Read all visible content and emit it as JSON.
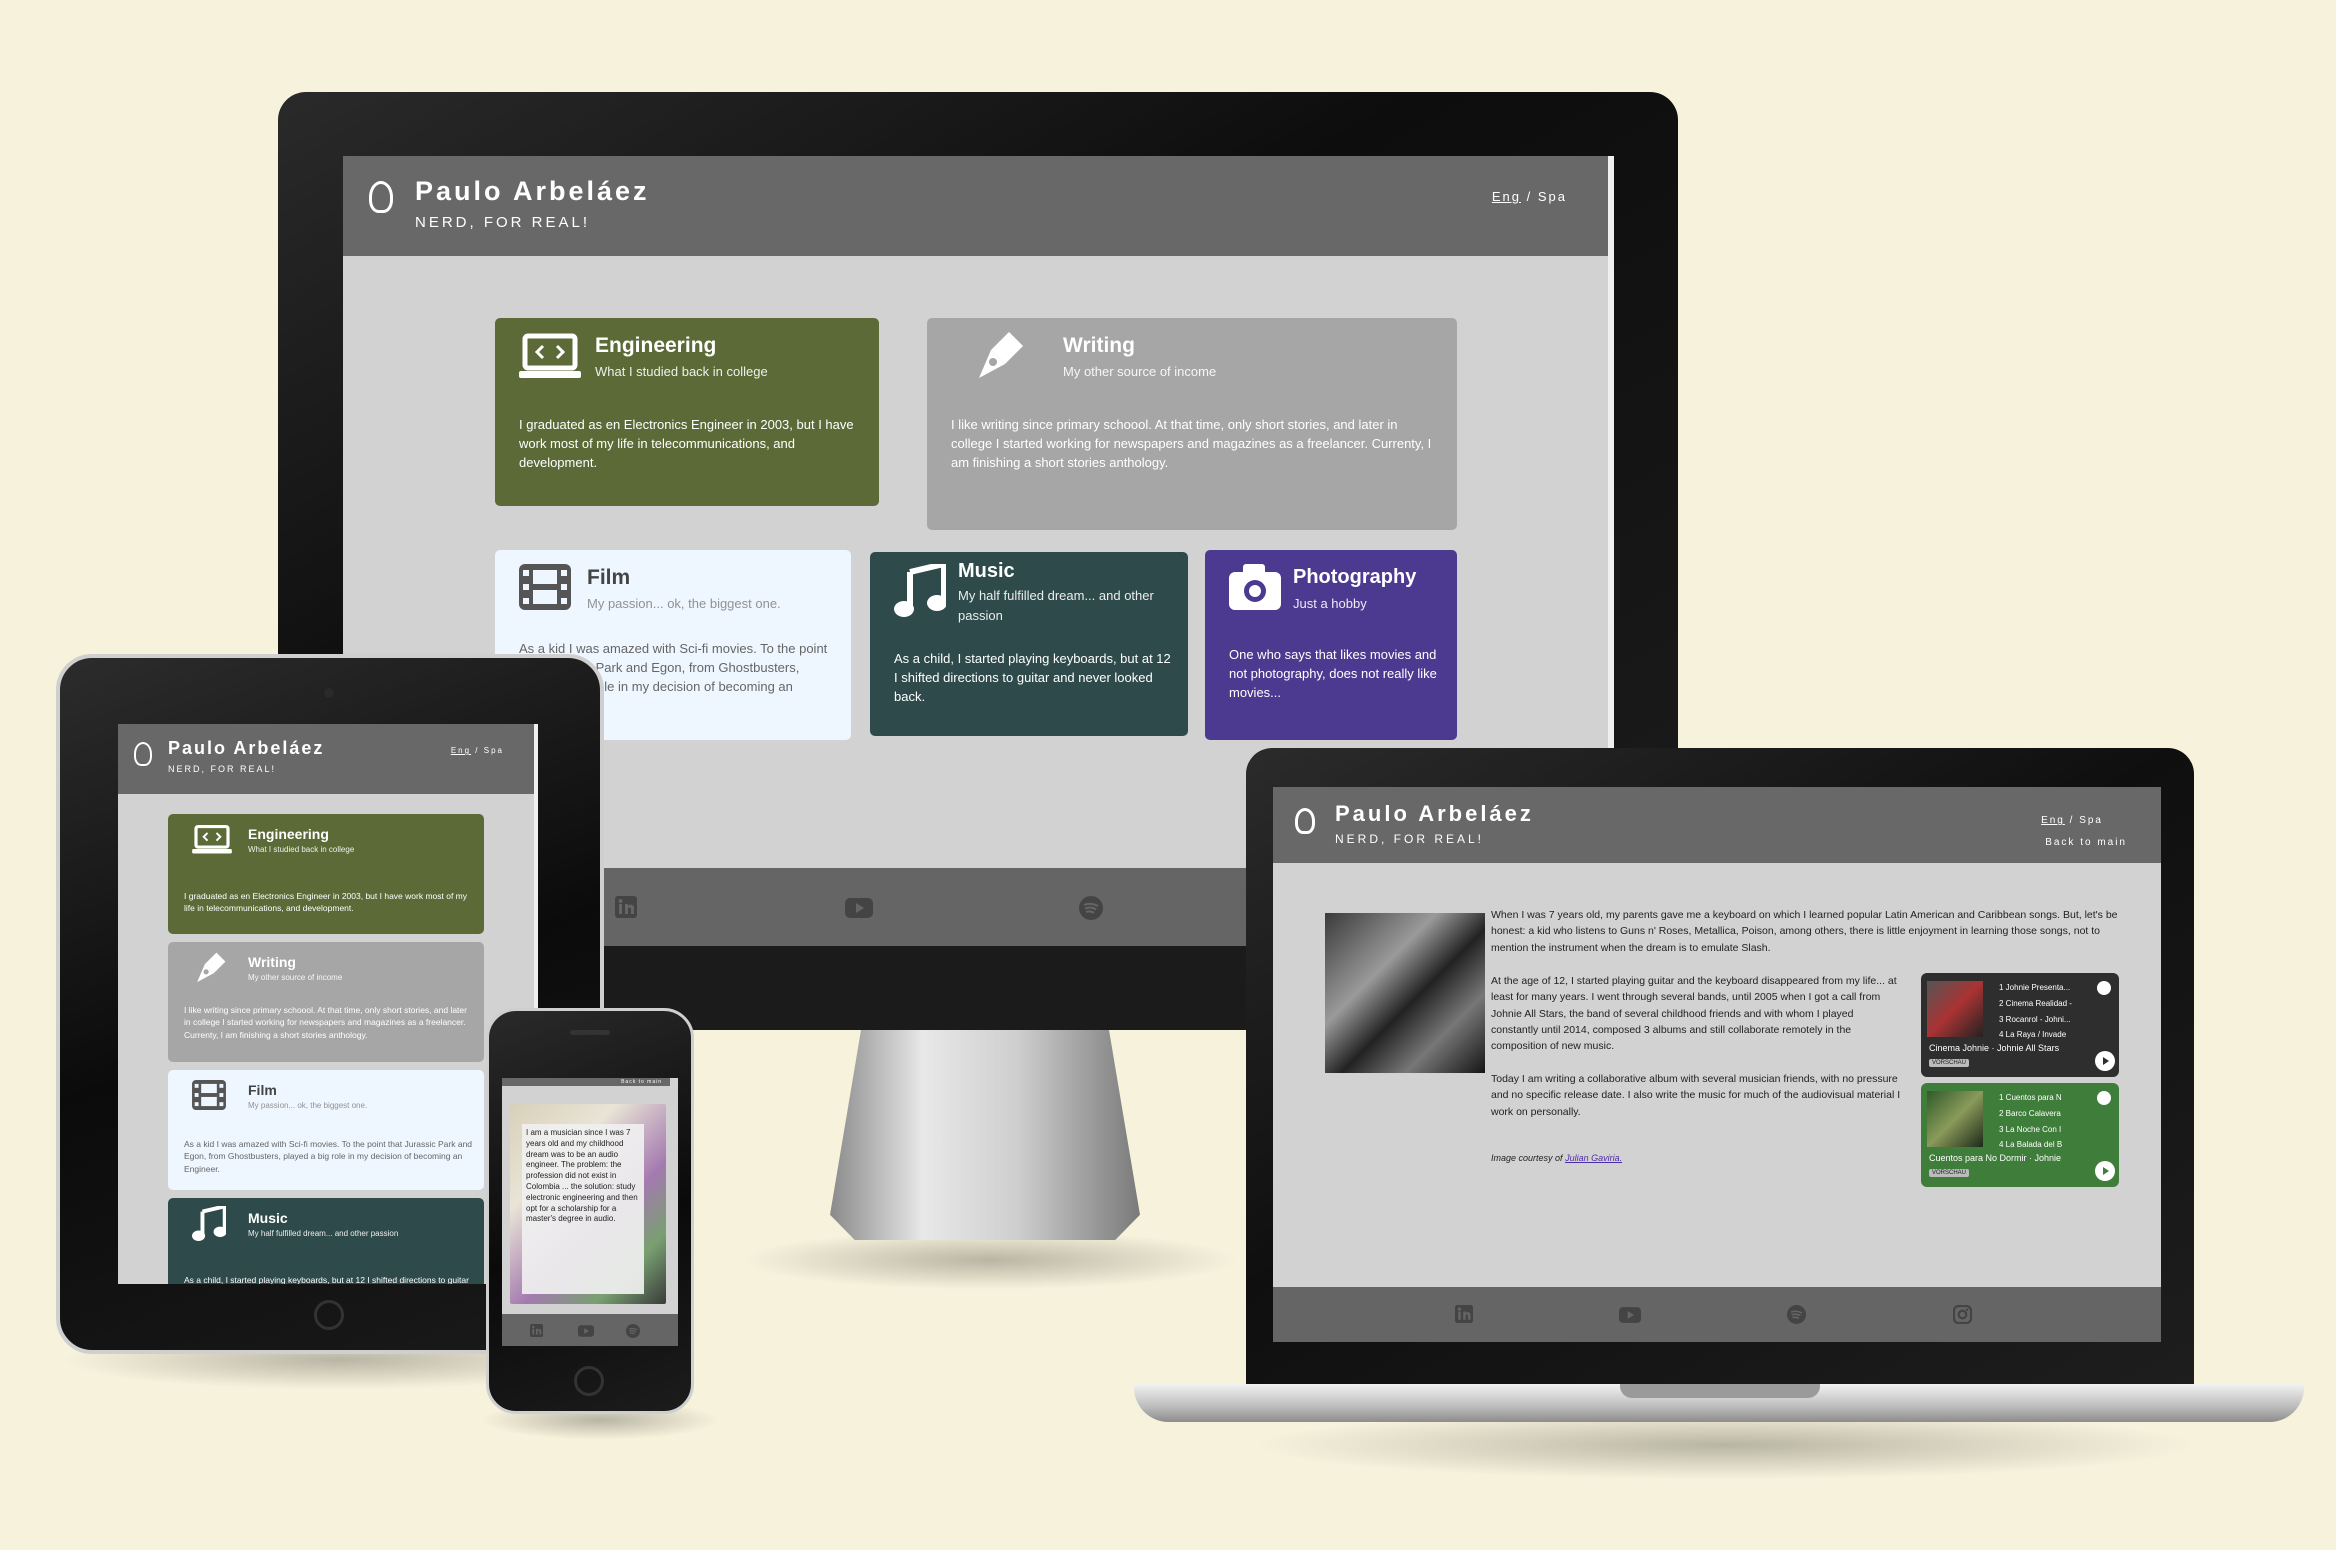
{
  "site": {
    "brand": "Paulo Arbeláez",
    "tagline": "NERD, FOR REAL!",
    "lang_eng": "Eng",
    "lang_sep": "/",
    "lang_spa": "Spa",
    "back_to_main": "Back to main"
  },
  "cards": {
    "engineering": {
      "title": "Engineering",
      "subtitle": "What I studied back in college",
      "body": "I graduated as en Electronics Engineer in 2003, but I have work most of my life in telecommunications, and development."
    },
    "writing": {
      "title": "Writing",
      "subtitle": "My other source of income",
      "body": "I like writing since primary schoool. At that time, only short stories, and later in college I started working for newspapers and magazines as a freelancer. Currenty, I am finishing a short stories anthology."
    },
    "film": {
      "title": "Film",
      "subtitle": "My passion... ok, the biggest one.",
      "body": "As a kid I was amazed with Sci-fi movies. To the point that Jurassic Park and Egon, from Ghostbusters, played a big role in my decision of becoming an Engineer.",
      "body_visible_desktop": "As a kid I was amazed with Sci-fi movies. To the point that Jurassic Park and Egon, from Ghostbusters, played a big role in my decision of becoming an Engineer."
    },
    "music": {
      "title": "Music",
      "subtitle": "My half fulfilled dream... and other passion",
      "body": "As a child, I started playing keyboards, but at 12 I shifted directions to guitar and never looked back."
    },
    "photography": {
      "title": "Photography",
      "subtitle": "Just a hobby",
      "body": "One who says that likes movies and not photography, does not really like movies..."
    }
  },
  "phone": {
    "back": "Back to main",
    "body": "I am a musician since I was 7 years old and my childhood dream was to be an audio engineer. The problem: the profession did not exist in Colombia ... the solution: study electronic engineering and then opt for a scholarship for a master's degree in audio."
  },
  "music_page": {
    "p1": "When I was 7 years old, my parents gave me a keyboard on which I learned popular Latin American and Caribbean songs. But, let's be honest: a kid who listens to Guns n' Roses, Metallica, Poison, among others, there is little enjoyment in learning those songs, not to mention the instrument when the dream is to emulate Slash.",
    "p2": "At the age of 12, I started playing guitar and the keyboard disappeared from my life... at least for many years. I went through several bands, until 2005 when I got a call from Johnie All Stars, the band of several childhood friends and with whom I played constantly until 2014, composed 3 albums and still collaborate remotely in the composition of new music.",
    "p3": "Today I am writing a collaborative album with several musician friends, with no pressure and no specific release date. I also write the music for much of the audiovisual material I work on personally.",
    "credit_prefix": "Image courtesy of",
    "credit_link": "Julian Gaviria.",
    "player1": {
      "title": "Cinema Johnie · Johnie All Stars",
      "preview": "VORSCHAU",
      "tracks": [
        "1  Johnie Presenta...",
        "2  Cinema Realidad -",
        "3  Rocanrol - Johni...",
        "4  La Raya / Invade"
      ]
    },
    "player2": {
      "title": "Cuentos para No Dormir · Johnie",
      "preview": "VORSCHAU",
      "tracks": [
        "1  Cuentos para N",
        "2  Barco Calavera",
        "3  La Noche Con I",
        "4  La Balada del B"
      ]
    }
  },
  "colors": {
    "background": "#f7f2dc",
    "header": "#686868",
    "engineering": "#5b6a37",
    "writing": "#a6a6a6",
    "film": "#eef6ff",
    "music": "#2f4a4b",
    "photography": "#4b3a8f",
    "spotify_dark": "#2e2e2e",
    "spotify_green": "#3f7d3a"
  },
  "icons": {
    "logo": "lightbulb-icon",
    "engineering": "laptop-code-icon",
    "writing": "pen-nib-icon",
    "film": "film-icon",
    "music": "music-icon",
    "photography": "camera-icon",
    "footer": [
      "linkedin-icon",
      "youtube-icon",
      "spotify-icon",
      "instagram-icon"
    ]
  }
}
